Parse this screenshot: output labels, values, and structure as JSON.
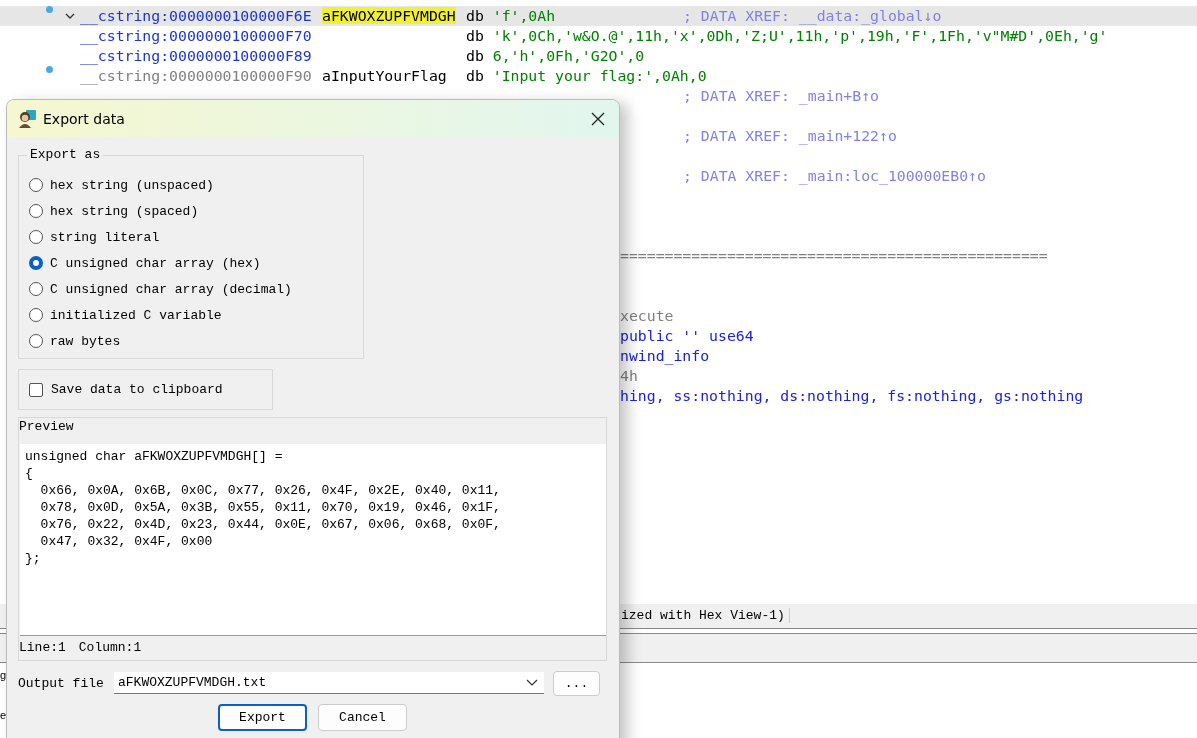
{
  "listing": {
    "rows": [
      {
        "kind": "data",
        "bullet": true,
        "expanded": true,
        "current": true,
        "dim": false,
        "address": "__cstring:0000000100000F6E",
        "name": "aFKWOXZUPFVMDGH",
        "op": "db",
        "operands": "'f',0Ah",
        "comment": "; DATA XREF: __data:_global↓o"
      },
      {
        "kind": "data",
        "bullet": false,
        "current": false,
        "dim": false,
        "address": "__cstring:0000000100000F70",
        "op": "db",
        "operands": "'k',0Ch,'w&O.@',11h,'x',0Dh,'Z;U',11h,'p',19h,'F',1Fh,'v\"M#D',0Eh,'g'"
      },
      {
        "kind": "data",
        "bullet": false,
        "current": false,
        "dim": false,
        "address": "__cstring:0000000100000F89",
        "op": "db",
        "operands": "6,'h',0Fh,'G2O',0"
      },
      {
        "kind": "data",
        "bullet": true,
        "current": false,
        "dim": true,
        "address": "__cstring:0000000100000F90",
        "name": "aInputYourFlag",
        "op": "db",
        "operands": "'Input your flag:',0Ah,0"
      },
      {
        "kind": "comment",
        "text": "; DATA XREF: _main+B↑o"
      },
      {
        "kind": "blank"
      },
      {
        "kind": "comment",
        "text": "; DATA XREF: _main+122↑o"
      },
      {
        "kind": "blank"
      },
      {
        "kind": "comment",
        "text": "; DATA XREF: _main:loc_100000EB0↑o"
      },
      {
        "kind": "blank"
      },
      {
        "kind": "blank"
      },
      {
        "kind": "blank"
      },
      {
        "kind": "separator",
        "text": "================================================"
      },
      {
        "kind": "blank"
      },
      {
        "kind": "blank"
      },
      {
        "kind": "tail",
        "dim": true,
        "text": "xecute"
      },
      {
        "kind": "tail",
        "dim": false,
        "text": " public '' use64"
      },
      {
        "kind": "tail",
        "dim": false,
        "text": "nwind_info"
      },
      {
        "kind": "tail",
        "dim": true,
        "text": "4h"
      },
      {
        "kind": "tail",
        "dim": false,
        "text": "hing, ss:nothing, ds:nothing, fs:nothing, gs:nothing"
      }
    ]
  },
  "status_bar": {
    "text": "ized with Hex View-1)"
  },
  "edge_fragments": [
    "g",
    "e"
  ],
  "dialog": {
    "title": "Export data",
    "export_as": {
      "label": "Export as",
      "options": [
        {
          "label": "hex string (unspaced)",
          "selected": false
        },
        {
          "label": "hex string (spaced)",
          "selected": false
        },
        {
          "label": "string literal",
          "selected": false
        },
        {
          "label": "C unsigned char array (hex)",
          "selected": true
        },
        {
          "label": "C unsigned char array (decimal)",
          "selected": false
        },
        {
          "label": "initialized C variable",
          "selected": false
        },
        {
          "label": "raw bytes",
          "selected": false
        }
      ]
    },
    "save_to_clipboard": {
      "label": "Save data to clipboard",
      "checked": false
    },
    "preview": {
      "label": "Preview",
      "lines": [
        "unsigned char aFKWOXZUPFVMDGH[] =",
        "{",
        "  0x66, 0x0A, 0x6B, 0x0C, 0x77, 0x26, 0x4F, 0x2E, 0x40, 0x11,",
        "  0x78, 0x0D, 0x5A, 0x3B, 0x55, 0x11, 0x70, 0x19, 0x46, 0x1F,",
        "  0x76, 0x22, 0x4D, 0x23, 0x44, 0x0E, 0x67, 0x06, 0x68, 0x0F,",
        "  0x47, 0x32, 0x4F, 0x00",
        "};"
      ],
      "line": "Line:1",
      "column": "Column:1"
    },
    "output_file": {
      "label": "Output file",
      "value": "aFKWOXZUPFVMDGH.txt"
    },
    "browse_button": "...",
    "buttons": [
      {
        "label": "Export",
        "default": true
      },
      {
        "label": "Cancel",
        "default": false
      }
    ]
  }
}
